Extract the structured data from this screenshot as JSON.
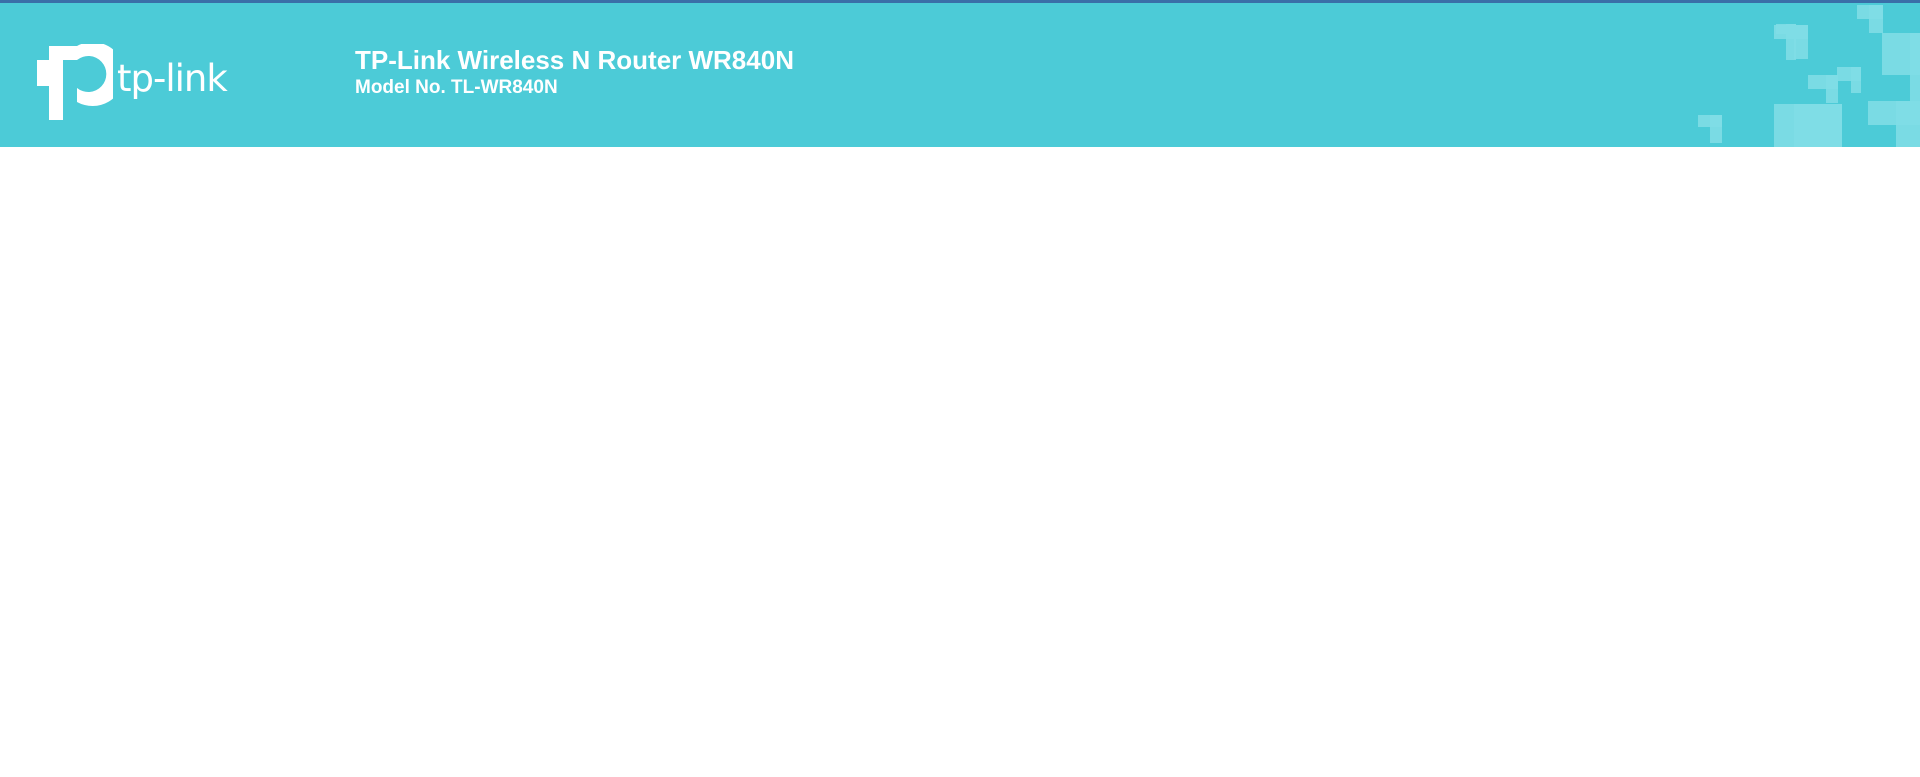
{
  "header": {
    "brand": {
      "logo_text": "tp-link",
      "icon": "tp-link-logo-icon"
    },
    "product_title": "TP-Link Wireless N Router WR840N",
    "model_number": "Model No. TL-WR840N",
    "colors": {
      "header_background": "#4ccbd7",
      "header_top_border": "#3a6fa8",
      "decoration": "#7fdde5",
      "text": "#ffffff"
    }
  },
  "content": {}
}
